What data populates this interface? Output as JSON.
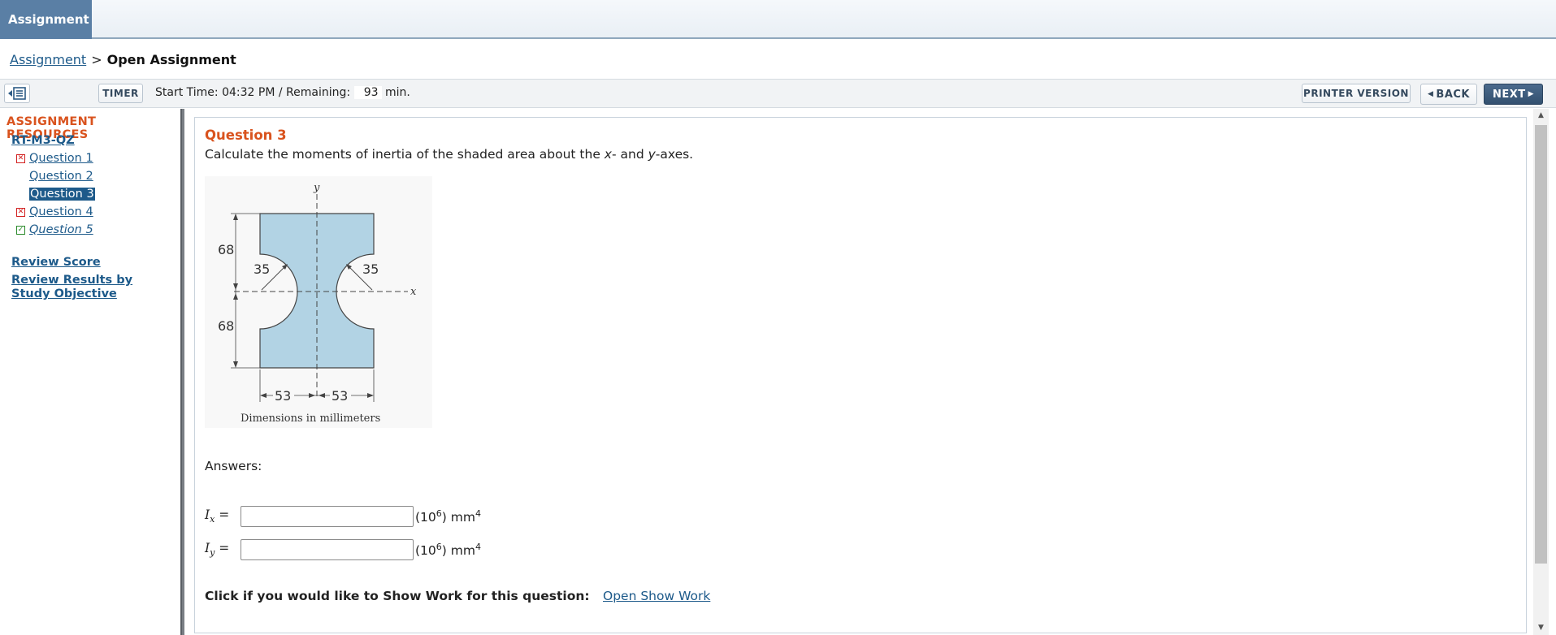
{
  "topbar": {
    "tab_label": "Assignment"
  },
  "breadcrumb": {
    "link": "Assignment",
    "separator": ">",
    "current": "Open Assignment"
  },
  "toolbar": {
    "timer_label": "TIMER",
    "start_time_text": "Start Time: 04:32 PM / Remaining:",
    "remaining_value": "93",
    "remaining_unit": "min.",
    "printer_label": "PRINTER VERSION",
    "back_label": "BACK",
    "next_label": "NEXT"
  },
  "sidebar": {
    "title": "ASSIGNMENT RESOURCES",
    "assignment_link": "RT-M3-QZ",
    "questions": [
      {
        "label": "Question 1",
        "status": "wrong"
      },
      {
        "label": "Question 2",
        "status": "none"
      },
      {
        "label": "Question 3",
        "status": "current"
      },
      {
        "label": "Question 4",
        "status": "wrong"
      },
      {
        "label": "Question 5",
        "status": "correct"
      }
    ],
    "review_score": "Review Score",
    "review_results": "Review Results by Study Objective"
  },
  "question": {
    "title": "Question 3",
    "text_prefix": "Calculate the moments of inertia of the shaded area about the ",
    "text_x": "x",
    "text_mid": "- and ",
    "text_y": "y",
    "text_suffix": "-axes.",
    "figure": {
      "axis_y": "y",
      "axis_x": "x",
      "dim_top": "68",
      "dim_bottom": "68",
      "radius_left": "35",
      "radius_right": "35",
      "width_left": "53",
      "width_right": "53",
      "caption": "Dimensions in millimeters"
    },
    "answers_label": "Answers:",
    "answers": [
      {
        "var": "I",
        "sub": "x",
        "eq": "=",
        "value": "",
        "unit_pre": "(10",
        "unit_exp": "6",
        "unit_post": ") mm",
        "unit_pow": "4"
      },
      {
        "var": "I",
        "sub": "y",
        "eq": "=",
        "value": "",
        "unit_pre": "(10",
        "unit_exp": "6",
        "unit_post": ") mm",
        "unit_pow": "4"
      }
    ],
    "show_work_text": "Click if you would like to Show Work for this question:",
    "show_work_link": "Open Show Work"
  }
}
